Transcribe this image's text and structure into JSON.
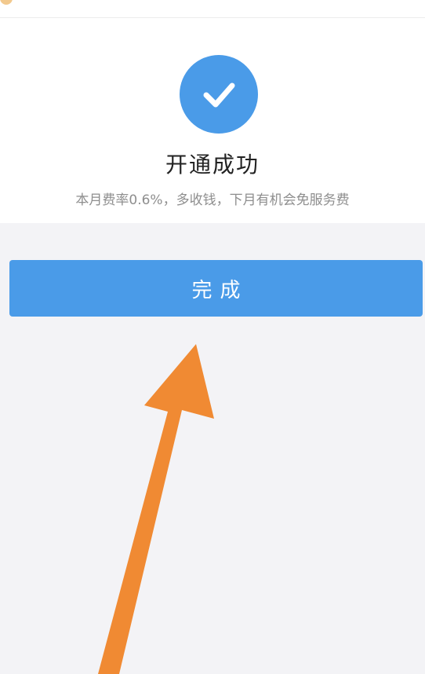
{
  "result": {
    "title": "开通成功",
    "subtitle": "本月费率0.6%，多收钱，下月有机会免服务费",
    "icon": "check-icon",
    "accent_color": "#4a9be8"
  },
  "actions": {
    "done_label": "完成"
  },
  "annotation": {
    "arrow_color": "#f08a33"
  }
}
